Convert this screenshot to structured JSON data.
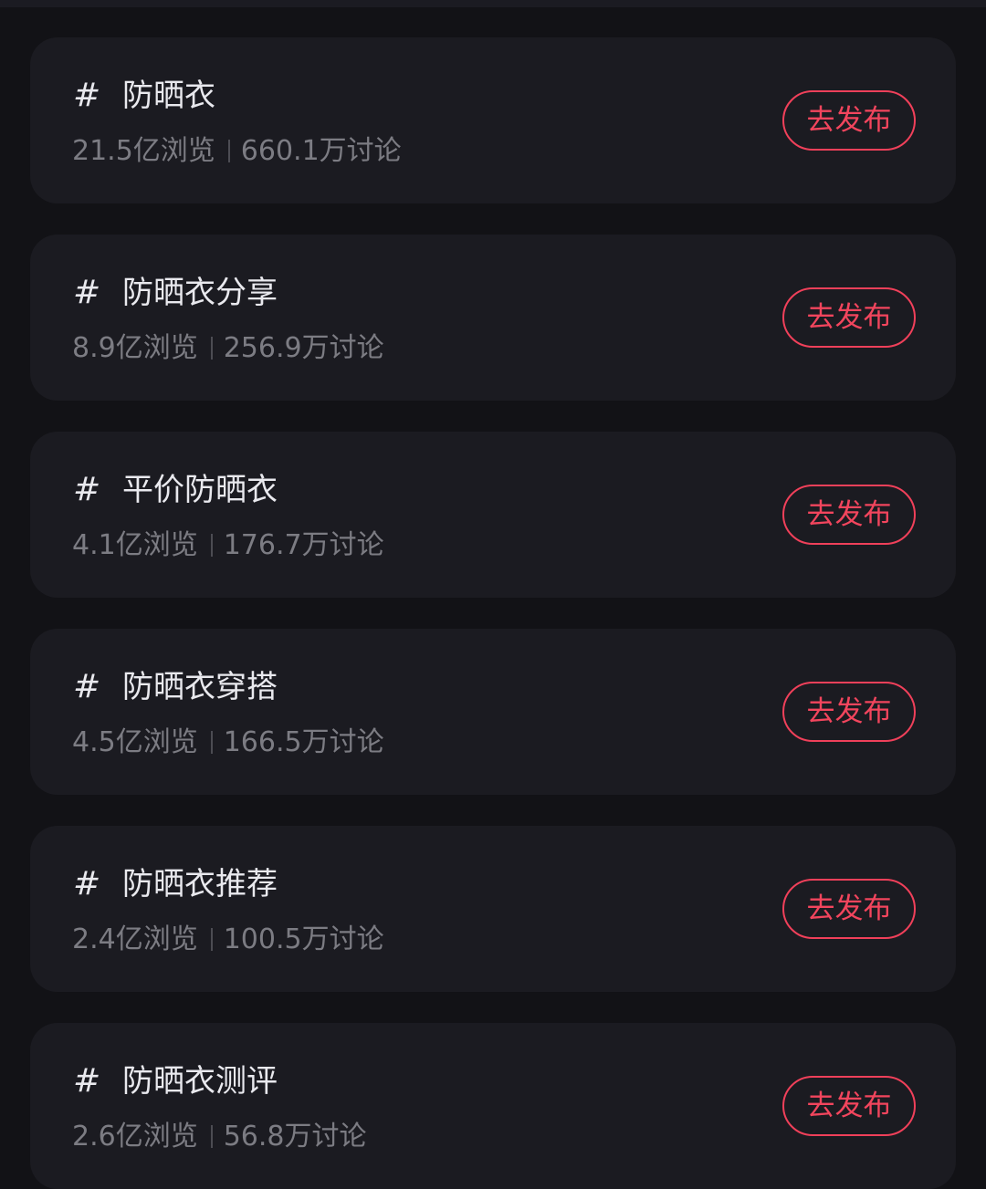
{
  "topics": [
    {
      "hash": "#",
      "title": "防晒衣",
      "views": "21.5亿浏览",
      "discussions": "660.1万讨论",
      "action_label": "去发布"
    },
    {
      "hash": "#",
      "title": "防晒衣分享",
      "views": "8.9亿浏览",
      "discussions": "256.9万讨论",
      "action_label": "去发布"
    },
    {
      "hash": "#",
      "title": "平价防晒衣",
      "views": "4.1亿浏览",
      "discussions": "176.7万讨论",
      "action_label": "去发布"
    },
    {
      "hash": "#",
      "title": "防晒衣穿搭",
      "views": "4.5亿浏览",
      "discussions": "166.5万讨论",
      "action_label": "去发布"
    },
    {
      "hash": "#",
      "title": "防晒衣推荐",
      "views": "2.4亿浏览",
      "discussions": "100.5万讨论",
      "action_label": "去发布"
    },
    {
      "hash": "#",
      "title": "防晒衣测评",
      "views": "2.6亿浏览",
      "discussions": "56.8万讨论",
      "action_label": "去发布"
    }
  ],
  "colors": {
    "background": "#121216",
    "card": "#1b1b21",
    "title": "#e9e9ee",
    "secondary_text": "#7c7c83",
    "accent": "#f0405a"
  },
  "icons": {
    "topic_marker": "hashtag-icon"
  }
}
